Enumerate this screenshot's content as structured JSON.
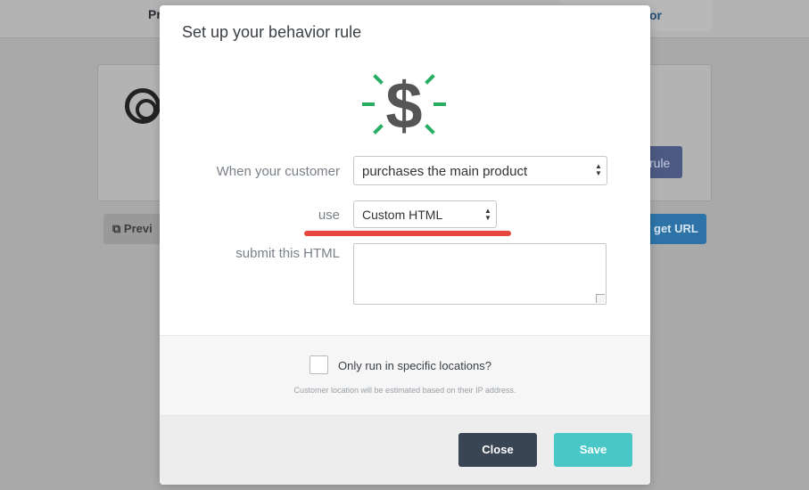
{
  "background": {
    "tab_left": "Pr",
    "tab_right": "or",
    "rule_button": "rule",
    "preview_button": "Previ",
    "url_button": "get URL"
  },
  "modal": {
    "title": "Set up your behavior rule",
    "icon": "dollar-sign-icon",
    "icon_colors": {
      "symbol": "#555555",
      "rays": "#27ae60"
    },
    "customer_label": "When your customer",
    "customer_select": "purchases the main product",
    "use_label": "use",
    "use_select": "Custom HTML",
    "html_label": "submit this HTML",
    "html_value": "",
    "location_checkbox_label": "Only run in specific locations?",
    "location_checked": false,
    "location_note": "Customer location will be estimated based on their IP address.",
    "close_button": "Close",
    "save_button": "Save",
    "highlight_color": "#e8473d"
  }
}
